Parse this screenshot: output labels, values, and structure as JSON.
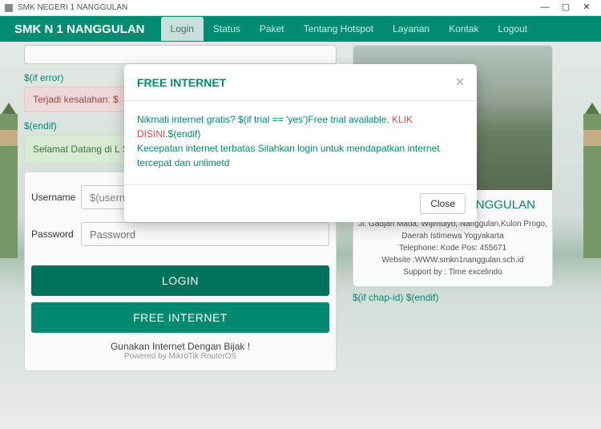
{
  "window": {
    "title": "SMK NEGERI 1 NANGGULAN"
  },
  "nav": {
    "brand": "SMK N 1 NANGGULAN",
    "items": [
      "Login",
      "Status",
      "Paket",
      "Tentang Hotspot",
      "Layanan",
      "Kontak",
      "Logout"
    ]
  },
  "macros": {
    "if_error": "$(if error)",
    "endif": "$(endif)",
    "chap": "$(if chap-id) $(endif)"
  },
  "alerts": {
    "error": "Terjadi kesalahan: $",
    "welcome": "Selamat Datang di L\nSilahkan login dulu u\nberbasis hotspot."
  },
  "form": {
    "username_label": "Username",
    "username_value": "$(username)",
    "password_label": "Password",
    "password_placeholder": "Password",
    "login_btn": "LOGIN",
    "free_btn": "FREE INTERNET",
    "footer1": "Gunakan Internet Dengan Bijak !",
    "footer2": "Powered by MikroTik RouterOS"
  },
  "card": {
    "title": "SMK NEGERI 1 NANGGULAN",
    "addr": "Jl. Gadjah Mada, Wijimulyo, Nanggulan,Kulon Progo, Daerah Istimewa Yogyakarta",
    "tel": "Telephone: Kode Pos: 455671",
    "web": "Website :WWW.smkn1nanggulan.sch.id",
    "support": "Support by : Time excelindo"
  },
  "modal": {
    "title": "FREE INTERNET",
    "line1a": "Nikmati internet gratis? $(if trial == 'yes')Free trial available, ",
    "line1b": "KLIK DISINI",
    "line1c": ".$(endif)",
    "line2": "Kecepatan internet terbatas Silahkan login untuk mendapatkan internet tercepat dan unlimetd",
    "close_btn": "Close"
  }
}
